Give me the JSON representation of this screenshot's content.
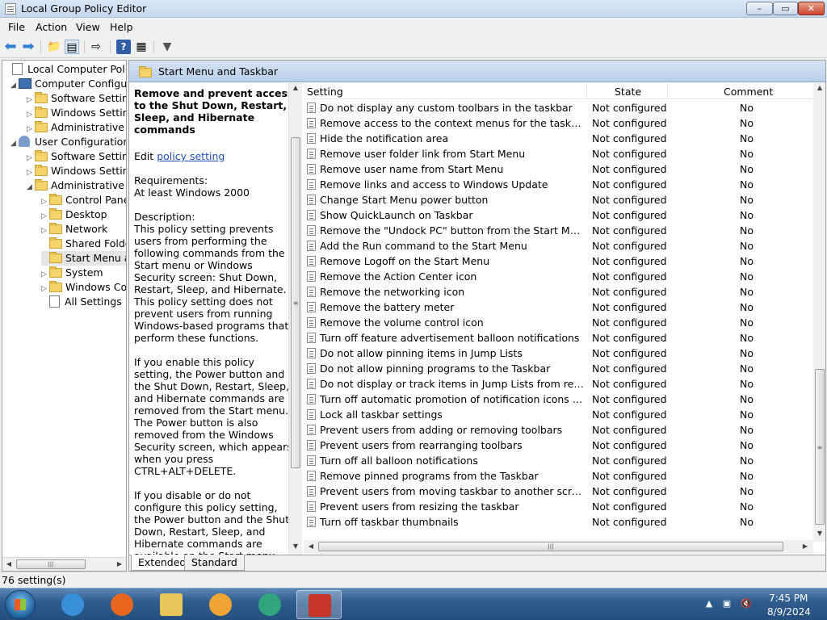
{
  "window": {
    "title": "Local Group Policy Editor",
    "min": "–",
    "max": "▭",
    "close": "✕"
  },
  "menu": [
    "File",
    "Action",
    "View",
    "Help"
  ],
  "tree": {
    "items": [
      {
        "label": "Local Computer Policy",
        "level": 0,
        "icon": "doc-icon",
        "arrow": ""
      },
      {
        "label": "Computer Configura",
        "level": 1,
        "icon": "computer-icon",
        "arrow": "◢"
      },
      {
        "label": "Software Settings",
        "level": 2,
        "icon": "folder-icon",
        "arrow": "▷"
      },
      {
        "label": "Windows Setting",
        "level": 2,
        "icon": "folder-icon",
        "arrow": "▷"
      },
      {
        "label": "Administrative Te",
        "level": 2,
        "icon": "folder-icon",
        "arrow": "▷"
      },
      {
        "label": "User Configuration",
        "level": 1,
        "icon": "user-icon",
        "arrow": "◢"
      },
      {
        "label": "Software Settings",
        "level": 2,
        "icon": "folder-icon",
        "arrow": "▷"
      },
      {
        "label": "Windows Setting",
        "level": 2,
        "icon": "folder-icon",
        "arrow": "▷"
      },
      {
        "label": "Administrative Te",
        "level": 2,
        "icon": "folder-icon",
        "arrow": "◢"
      },
      {
        "label": "Control Panel",
        "level": 3,
        "icon": "folder-icon",
        "arrow": "▷"
      },
      {
        "label": "Desktop",
        "level": 3,
        "icon": "folder-icon",
        "arrow": "▷"
      },
      {
        "label": "Network",
        "level": 3,
        "icon": "folder-icon",
        "arrow": "▷"
      },
      {
        "label": "Shared Folder",
        "level": 3,
        "icon": "folder-icon",
        "arrow": ""
      },
      {
        "label": "Start Menu ar",
        "level": 3,
        "icon": "folder-icon",
        "arrow": "",
        "selected": true
      },
      {
        "label": "System",
        "level": 3,
        "icon": "folder-icon",
        "arrow": "▷"
      },
      {
        "label": "Windows Cor",
        "level": 3,
        "icon": "folder-icon",
        "arrow": "▷"
      },
      {
        "label": "All Settings",
        "level": 3,
        "icon": "all-settings-icon",
        "arrow": ""
      }
    ]
  },
  "pane": {
    "title": "Start Menu and Taskbar"
  },
  "description": {
    "title": "Remove and prevent access to the Shut Down, Restart, Sleep, and Hibernate commands",
    "edit_prefix": "Edit",
    "edit_link": "policy setting",
    "requirements_label": "Requirements:",
    "requirements_value": "At least Windows 2000",
    "description_label": "Description:",
    "p1": "This policy setting prevents users from performing the following commands from the Start menu or Windows Security screen: Shut Down, Restart, Sleep, and Hibernate. This policy setting does not prevent users from running Windows-based programs that perform these functions.",
    "p2": "If you enable this policy setting, the Power button and the Shut Down, Restart, Sleep, and Hibernate commands are removed from the Start menu. The Power button is also removed from the Windows Security screen, which appears when you press CTRL+ALT+DELETE.",
    "p3": "If you disable or do not configure this policy setting, the Power button and the Shut Down, Restart, Sleep, and Hibernate commands are available on the Start menu. The Power button on the Windows Security screen is also available."
  },
  "list": {
    "columns": {
      "setting": "Setting",
      "state": "State",
      "comment": "Comment"
    },
    "rows": [
      [
        "Do not display any custom toolbars in the taskbar",
        "Not configured",
        "No"
      ],
      [
        "Remove access to the context menus for the taskbar",
        "Not configured",
        "No"
      ],
      [
        "Hide the notification area",
        "Not configured",
        "No"
      ],
      [
        "Remove user folder link from Start Menu",
        "Not configured",
        "No"
      ],
      [
        "Remove user name from Start Menu",
        "Not configured",
        "No"
      ],
      [
        "Remove links and access to Windows Update",
        "Not configured",
        "No"
      ],
      [
        "Change Start Menu power button",
        "Not configured",
        "No"
      ],
      [
        "Show QuickLaunch on Taskbar",
        "Not configured",
        "No"
      ],
      [
        "Remove the \"Undock PC\" button from the Start Menu",
        "Not configured",
        "No"
      ],
      [
        "Add the Run command to the Start Menu",
        "Not configured",
        "No"
      ],
      [
        "Remove Logoff on the Start Menu",
        "Not configured",
        "No"
      ],
      [
        "Remove the Action Center icon",
        "Not configured",
        "No"
      ],
      [
        "Remove the networking icon",
        "Not configured",
        "No"
      ],
      [
        "Remove the battery meter",
        "Not configured",
        "No"
      ],
      [
        "Remove the volume control icon",
        "Not configured",
        "No"
      ],
      [
        "Turn off feature advertisement balloon notifications",
        "Not configured",
        "No"
      ],
      [
        "Do not allow pinning items in Jump Lists",
        "Not configured",
        "No"
      ],
      [
        "Do not allow pinning programs to the Taskbar",
        "Not configured",
        "No"
      ],
      [
        "Do not display or track items in Jump Lists from remote loca...",
        "Not configured",
        "No"
      ],
      [
        "Turn off automatic promotion of notification icons to the ta...",
        "Not configured",
        "No"
      ],
      [
        "Lock all taskbar settings",
        "Not configured",
        "No"
      ],
      [
        "Prevent users from adding or removing toolbars",
        "Not configured",
        "No"
      ],
      [
        "Prevent users from rearranging toolbars",
        "Not configured",
        "No"
      ],
      [
        "Turn off all balloon notifications",
        "Not configured",
        "No"
      ],
      [
        "Remove pinned programs from the Taskbar",
        "Not configured",
        "No"
      ],
      [
        "Prevent users from moving taskbar to another screen dock l...",
        "Not configured",
        "No"
      ],
      [
        "Prevent users from resizing the taskbar",
        "Not configured",
        "No"
      ],
      [
        "Turn off taskbar thumbnails",
        "Not configured",
        "No"
      ]
    ]
  },
  "tabs": [
    "Extended",
    "Standard"
  ],
  "status": "76 setting(s)",
  "taskbar": {
    "apps": [
      {
        "name": "internet-explorer-icon",
        "color": "#3a8fd9"
      },
      {
        "name": "firefox-icon",
        "color": "#e8661f"
      },
      {
        "name": "file-explorer-icon",
        "color": "#e9c85a"
      },
      {
        "name": "media-player-icon",
        "color": "#f0a433"
      },
      {
        "name": "remote-app-icon",
        "color": "#2ea57a"
      },
      {
        "name": "toolbox-icon",
        "color": "#c8352b",
        "active": true
      }
    ],
    "time": "7:45 PM",
    "date": "8/9/2024"
  }
}
